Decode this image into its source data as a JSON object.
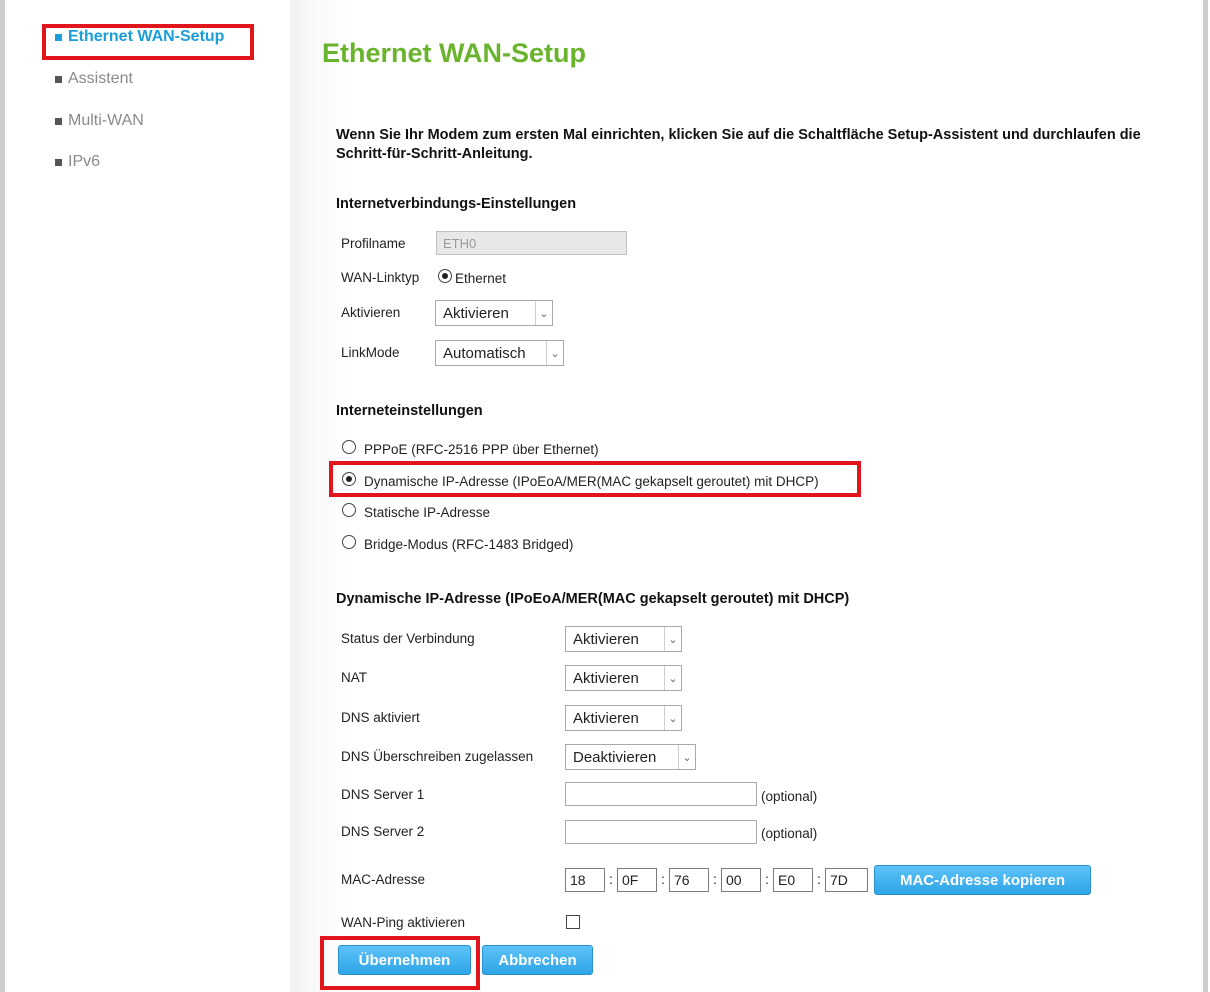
{
  "sidebar": {
    "items": [
      {
        "label": "Ethernet WAN-Setup",
        "active": true
      },
      {
        "label": "Assistent",
        "active": false
      },
      {
        "label": "Multi-WAN",
        "active": false
      },
      {
        "label": "IPv6",
        "active": false
      }
    ]
  },
  "page": {
    "title": "Ethernet WAN-Setup",
    "intro": "Wenn Sie Ihr Modem zum ersten Mal einrichten, klicken Sie auf die Schaltfläche Setup-Assistent und durchlaufen die Schritt-für-Schritt-Anleitung."
  },
  "connection_settings": {
    "title": "Internetverbindungs-Einstellungen",
    "profile_label": "Profilname",
    "profile_value": "ETH0",
    "link_type_label": "WAN-Linktyp",
    "link_type_option": "Ethernet",
    "activate_label": "Aktivieren",
    "activate_value": "Aktivieren",
    "linkmode_label": "LinkMode",
    "linkmode_value": "Automatisch"
  },
  "internet_settings": {
    "title": "Interneteinstellungen",
    "options": [
      {
        "label": "PPPoE (RFC-2516 PPP über Ethernet)",
        "selected": false
      },
      {
        "label": "Dynamische IP-Adresse (IPoEoA/MER(MAC gekapselt geroutet) mit DHCP)",
        "selected": true
      },
      {
        "label": "Statische IP-Adresse",
        "selected": false
      },
      {
        "label": "Bridge-Modus (RFC-1483 Bridged)",
        "selected": false
      }
    ]
  },
  "dhcp": {
    "title": "Dynamische IP-Adresse (IPoEoA/MER(MAC gekapselt geroutet) mit DHCP)",
    "status_label": "Status der Verbindung",
    "status_value": "Aktivieren",
    "nat_label": "NAT",
    "nat_value": "Aktivieren",
    "dns_label": "DNS aktiviert",
    "dns_value": "Aktivieren",
    "dns_override_label": "DNS Überschreiben zugelassen",
    "dns_override_value": "Deaktivieren",
    "dns1_label": "DNS Server 1",
    "dns1_value": "",
    "dns2_label": "DNS Server 2",
    "dns2_value": "",
    "optional": "(optional)",
    "mac_label": "MAC-Adresse",
    "mac": [
      "18",
      "0F",
      "76",
      "00",
      "E0",
      "7D"
    ],
    "mac_copy_button": "MAC-Adresse kopieren",
    "wan_ping_label": "WAN-Ping aktivieren",
    "wan_ping_checked": false
  },
  "actions": {
    "apply": "Übernehmen",
    "cancel": "Abbrechen"
  },
  "colors": {
    "title_green": "#6ab42d",
    "active_blue": "#1a9fd9",
    "button_blue": "#2fa4e7",
    "highlight_red": "#e0161c"
  }
}
